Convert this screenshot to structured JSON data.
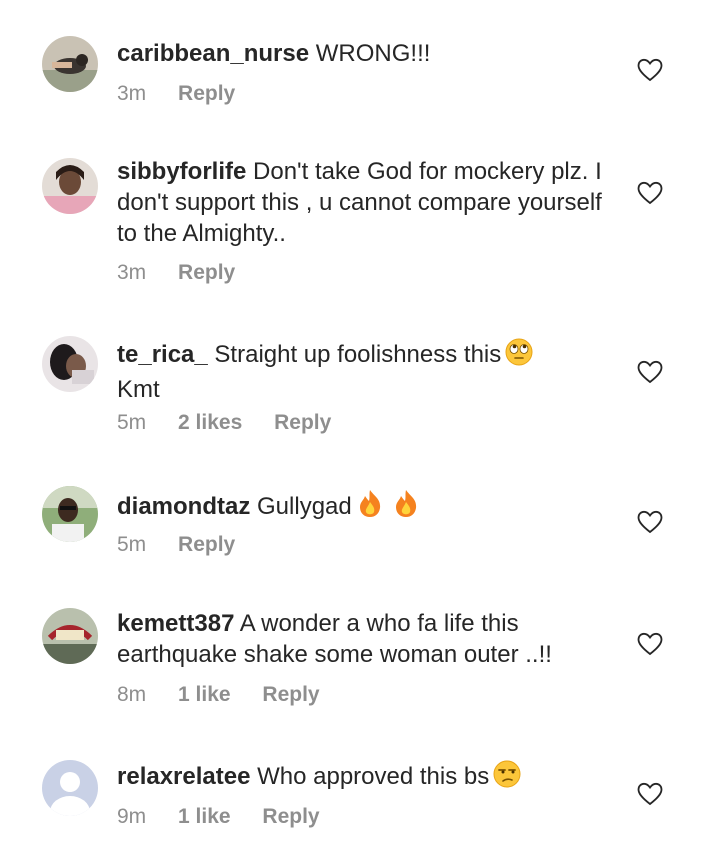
{
  "comments": [
    {
      "username": "caribbean_nurse",
      "text": "WRONG!!!",
      "time": "3m",
      "likes": "",
      "reply_label": "Reply",
      "avatar": "avatar-photo"
    },
    {
      "username": "sibbyforlife",
      "text": "Don't take God for mockery plz. I don't support this , u cannot compare yourself to the Almighty..",
      "time": "3m",
      "likes": "",
      "reply_label": "Reply",
      "avatar": "avatar-photo"
    },
    {
      "username": "te_rica_",
      "text": "Straight up foolishness this",
      "text2": "Kmt",
      "emoji": "eye-roll-emoji",
      "time": "5m",
      "likes": "2 likes",
      "reply_label": "Reply",
      "avatar": "avatar-photo"
    },
    {
      "username": "diamondtaz",
      "text": "Gullygad",
      "emoji": "fire-emoji",
      "time": "5m",
      "likes": "",
      "reply_label": "Reply",
      "avatar": "avatar-photo"
    },
    {
      "username": "kemett387",
      "text": "A wonder a who fa life this earthquake shake some woman outer ..!!",
      "time": "8m",
      "likes": "1 like",
      "reply_label": "Reply",
      "avatar": "avatar-photo"
    },
    {
      "username": "relaxrelatee",
      "text": "Who approved this bs",
      "emoji": "unamused-emoji",
      "time": "9m",
      "likes": "1 like",
      "reply_label": "Reply",
      "avatar": "default-avatar"
    }
  ],
  "colors": {
    "text": "#262626",
    "meta": "#8e8e8e"
  }
}
